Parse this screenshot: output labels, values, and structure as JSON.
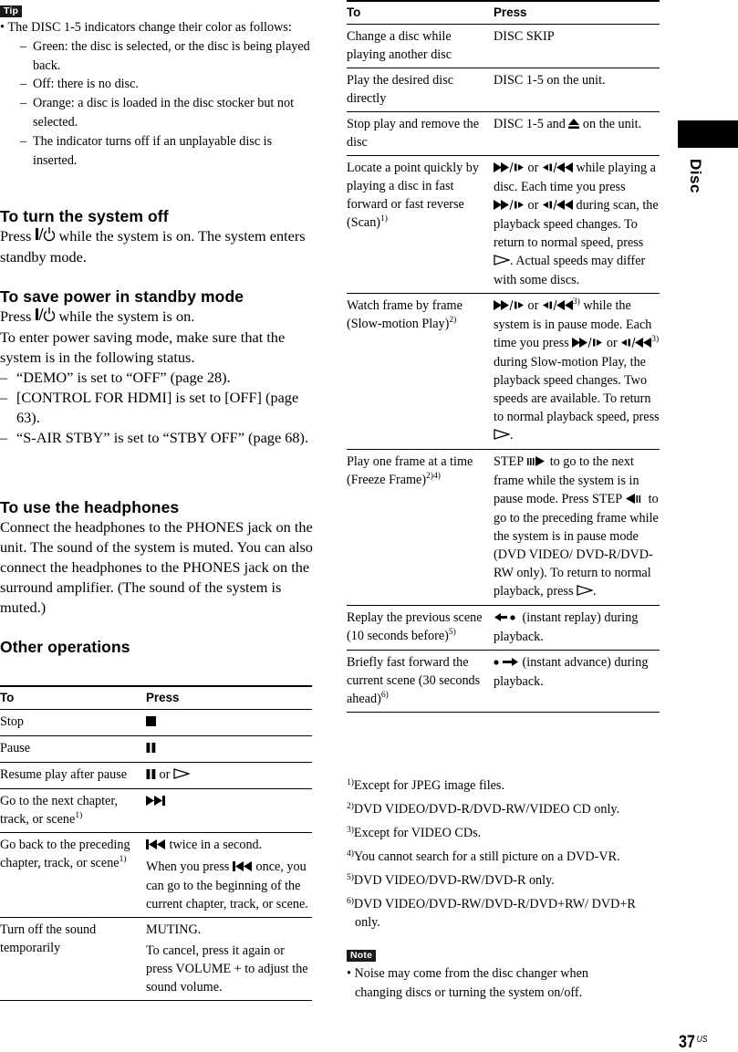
{
  "tip": {
    "label": "Tip",
    "bullet": "The DISC 1-5 indicators change their color as follows:",
    "items": [
      "Green: the disc is selected, or the disc is being played back.",
      "Off: there is no disc.",
      "Orange: a disc is loaded in the disc stocker but not selected.",
      "The indicator turns off if an unplayable disc is inserted."
    ]
  },
  "sections": {
    "turn_off": {
      "heading": "To turn the system off",
      "pre": "Press ",
      "post": " while the system is on. The system enters standby mode."
    },
    "save_power": {
      "heading": "To save power in standby mode",
      "pre": "Press ",
      "post": " while the system is on.",
      "para": "To enter power saving mode, make sure that the system is in the following status.",
      "items": [
        "“DEMO” is set to “OFF” (page 28).",
        "[CONTROL FOR HDMI] is set to [OFF] (page 63).",
        "“S-AIR STBY” is set to “STBY OFF” (page 68)."
      ]
    },
    "headphones": {
      "heading": "To use the headphones",
      "para": "Connect the headphones to the PHONES jack on the unit. The sound of the system is muted. You can also connect the headphones to the PHONES jack on the surround amplifier. (The sound of the system is muted.)"
    },
    "other_ops": {
      "heading": "Other operations"
    }
  },
  "left_table": {
    "headers": [
      "To",
      "Press"
    ],
    "rows": [
      {
        "to": "Stop",
        "press": ""
      },
      {
        "to": "Pause",
        "press": ""
      },
      {
        "to": "Resume play after pause",
        "press": " or "
      },
      {
        "to": "Go to the next chapter, track, or scene",
        "sup": "1)",
        "press": ""
      },
      {
        "to": "Go back to the preceding chapter, track, or scene",
        "sup": "1)",
        "press": " twice in a second.",
        "press2_pre": "When you press ",
        "press2_post": " once, you can go to the beginning of the current chapter, track, or scene."
      },
      {
        "to": "Turn off the sound temporarily",
        "press": "MUTING.",
        "press2": "To cancel, press it again or press VOLUME + to adjust the sound volume."
      }
    ]
  },
  "right_table": {
    "headers": [
      "To",
      "Press"
    ],
    "rows": [
      {
        "to": "Change a disc while playing another disc",
        "press": "DISC SKIP"
      },
      {
        "to": "Play the desired disc directly",
        "press": "DISC 1-5 on the unit."
      },
      {
        "to": "Stop play and remove the disc",
        "press_pre": "DISC 1-5 and ",
        "press_post": " on the unit."
      },
      {
        "to": "Locate a point quickly by playing a disc in fast forward or fast reverse (Scan)",
        "sup": "1)",
        "t1": " or ",
        "t2": " while playing a disc. Each time you press ",
        "t3": " or ",
        "t4": " during scan, the playback speed changes. To return to normal speed, press ",
        "t5": ". Actual speeds may differ with some discs."
      },
      {
        "to": "Watch frame by frame (Slow-motion Play)",
        "sup": "2)",
        "t1": " or ",
        "s1": "3)",
        "t2": " while the system is in pause mode. Each time you press ",
        "t3": " or ",
        "s2": "3)",
        "t4": " during Slow-motion Play, the playback speed changes. Two speeds are available. To return to normal playback speed, press ",
        "t5": "."
      },
      {
        "to": "Play one frame at a time (Freeze Frame)",
        "sup": "2)4)",
        "t1": "STEP ",
        "t2": " to go to the next frame while the system is in pause mode. Press STEP ",
        "t3": " to go to the preceding frame while the system is in pause mode (DVD VIDEO/ DVD-R/DVD-RW only). To return to normal playback, press ",
        "t4": "."
      },
      {
        "to": "Replay the previous scene (10 seconds before)",
        "sup": "5)",
        "press": " (instant replay) during playback."
      },
      {
        "to": "Briefly fast forward the current scene (30 seconds ahead)",
        "sup": "6)",
        "press": " (instant advance) during playback."
      }
    ]
  },
  "footnotes": [
    {
      "mark": "1)",
      "text": "Except for JPEG image files."
    },
    {
      "mark": "2)",
      "text": "DVD VIDEO/DVD-R/DVD-RW/VIDEO CD only."
    },
    {
      "mark": "3)",
      "text": "Except for VIDEO CDs."
    },
    {
      "mark": "4)",
      "text": "You cannot search for a still picture on a DVD-VR."
    },
    {
      "mark": "5)",
      "text": "DVD VIDEO/DVD-RW/DVD-R only."
    },
    {
      "mark": "6)",
      "text": "DVD VIDEO/DVD-RW/DVD-R/DVD+RW/ DVD+R only."
    }
  ],
  "note": {
    "label": "Note",
    "bullet": "Noise may come from the disc changer when changing discs or turning the system on/off."
  },
  "side_tab": {
    "label": "Disc"
  },
  "page": {
    "number": "37",
    "suffix": "US"
  }
}
